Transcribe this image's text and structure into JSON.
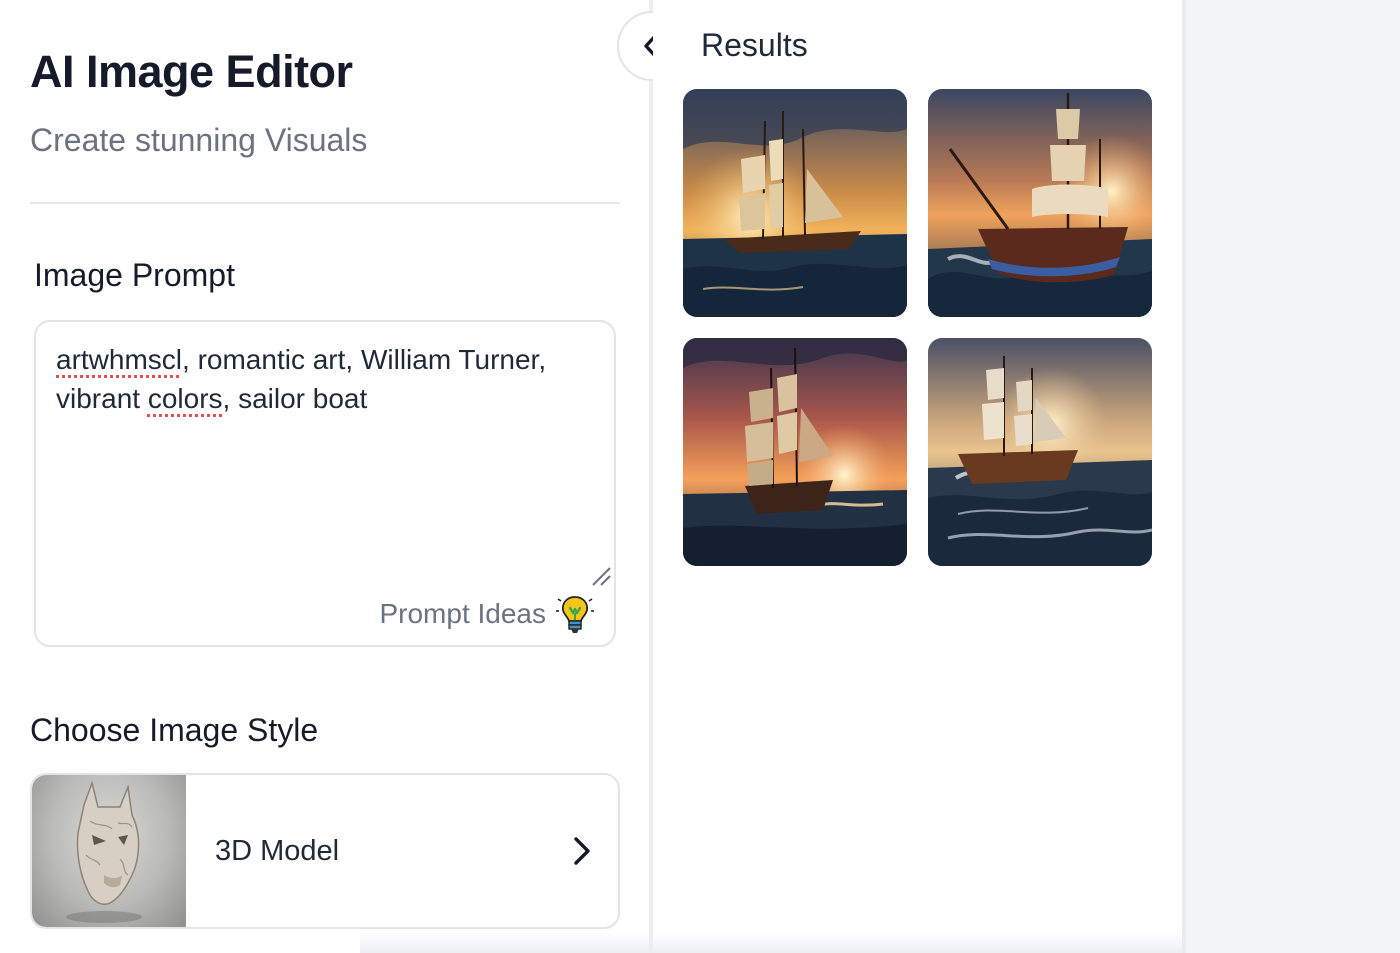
{
  "app": {
    "title": "AI Image Editor",
    "subtitle": "Create stunning Visuals"
  },
  "prompt": {
    "heading": "Image Prompt",
    "text_parts": {
      "misspelled_1": "artwhmscl",
      "middle": ", romantic art, William Turner, vibrant ",
      "misspelled_2": "colors",
      "end": ", sailor boat"
    },
    "ideas_label": "Prompt Ideas",
    "ideas_icon": "lightbulb-icon"
  },
  "style": {
    "heading": "Choose Image Style",
    "selected_label": "3D Model",
    "thumb_icon": "3d-mask-thumbnail",
    "chevron_icon": "chevron-right-icon"
  },
  "results": {
    "title": "Results",
    "collapse_icon": "chevron-left-icon",
    "image_count": 4
  },
  "colors": {
    "title_text": "#161b2b",
    "muted_text": "#6b7280",
    "border": "#e2e4e9",
    "spellcheck_underline": "#e05252",
    "bulb_yellow": "#f5c518",
    "bulb_green": "#3fa34d"
  }
}
